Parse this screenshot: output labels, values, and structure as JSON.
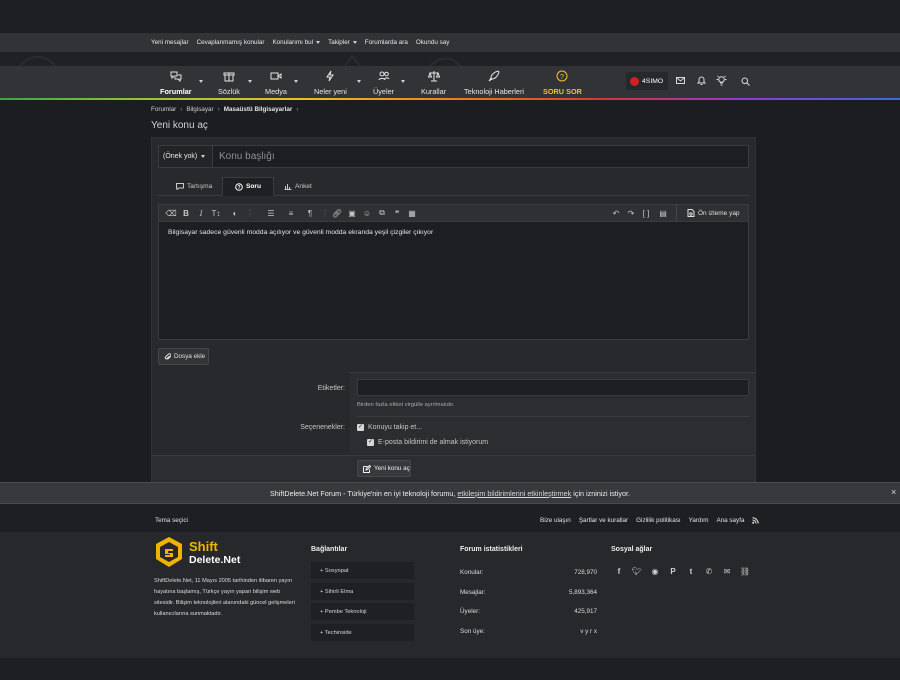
{
  "subnav": {
    "items": [
      {
        "label": "Yeni mesajlar",
        "caret": false
      },
      {
        "label": "Cevaplanmamış konular",
        "caret": false
      },
      {
        "label": "Konularımı bul",
        "caret": true
      },
      {
        "label": "Takipler",
        "caret": true
      },
      {
        "label": "Forumlarda ara",
        "caret": false
      },
      {
        "label": "Okundu say",
        "caret": false
      }
    ]
  },
  "nav": {
    "forums": "Forumlar",
    "dictionary": "Sözlük",
    "media": "Medya",
    "whats_new": "Neler yeni",
    "members": "Üyeler",
    "rules": "Kurallar",
    "tech_news": "Teknoloji Haberleri",
    "ask": "SORU SOR",
    "username": "4SIMO",
    "accent": "#f2c230"
  },
  "breadcrumb": {
    "items": [
      "Forumlar",
      "Bilgisayar",
      "Masaüstü Bilgisayarlar"
    ]
  },
  "page": {
    "title": "Yeni konu aç"
  },
  "form": {
    "prefix": "(Önek yok)",
    "title_placeholder": "Konu başlığı",
    "tabs": {
      "discussion": "Tartışma",
      "question": "Soru",
      "poll": "Anket"
    },
    "preview_label": "Ön izleme yap",
    "body": "Bilgisayar sadece güvenli modda açılıyor ve güvenli modda ekranda yeşil çizgiler çıkıyor",
    "attach_label": "Dosya ekle",
    "tags_label": "Etiketler:",
    "tags_hint": "Birden fazla etiket virgülle ayrılmalıdır.",
    "options_label": "Seçenenekler:",
    "option_watch": "Konuyu takip et...",
    "option_email": "E-posta bildirimi de almak istiyorum",
    "submit_label": "Yeni konu aç"
  },
  "notice": {
    "prefix": "ShiftDelete.Net Forum - Türkiye'nin en iyi teknoloji forumu,",
    "link": "etkileşim bildirimlerini etkinleştirmek",
    "suffix": "için izninizi istiyor.",
    "close": "×"
  },
  "footer": {
    "theme_picker": "Tema seçici",
    "links": [
      "Bize ulaşın",
      "Şartlar ve kurallar",
      "Gizlilik politikası",
      "Yardım",
      "Ana sayfa"
    ],
    "logo_top": "Shift",
    "logo_bottom": "Delete.Net",
    "about": "ShiftDelete.Net, 11 Mayıs 2005 tarihinden itibaren yayın hayatına başlamış, Türkçe yayın yapan bilişim web sitesidir. Bilişim teknolojileri alanındaki güncel gelişmeleri kullanıcılarına sunmaktadır.",
    "links_heading": "Bağlantılar",
    "link_boxes": [
      "+ Sosyopat",
      "+ Sihirli Elma",
      "+ Pembe Teknoloji",
      "+ Techinside"
    ],
    "stats_heading": "Forum istatistikleri",
    "stats": [
      {
        "label": "Konular:",
        "value": "728,970"
      },
      {
        "label": "Mesajlar:",
        "value": "5,893,364"
      },
      {
        "label": "Üyeler:",
        "value": "425,917"
      },
      {
        "label": "Son üye:",
        "value": "v y r x"
      }
    ],
    "social_heading": "Sosyal ağlar",
    "social_icons": [
      "facebook-icon",
      "twitter-icon",
      "reddit-icon",
      "pinterest-icon",
      "tumblr-icon",
      "whatsapp-icon",
      "email-icon",
      "link-icon"
    ]
  }
}
